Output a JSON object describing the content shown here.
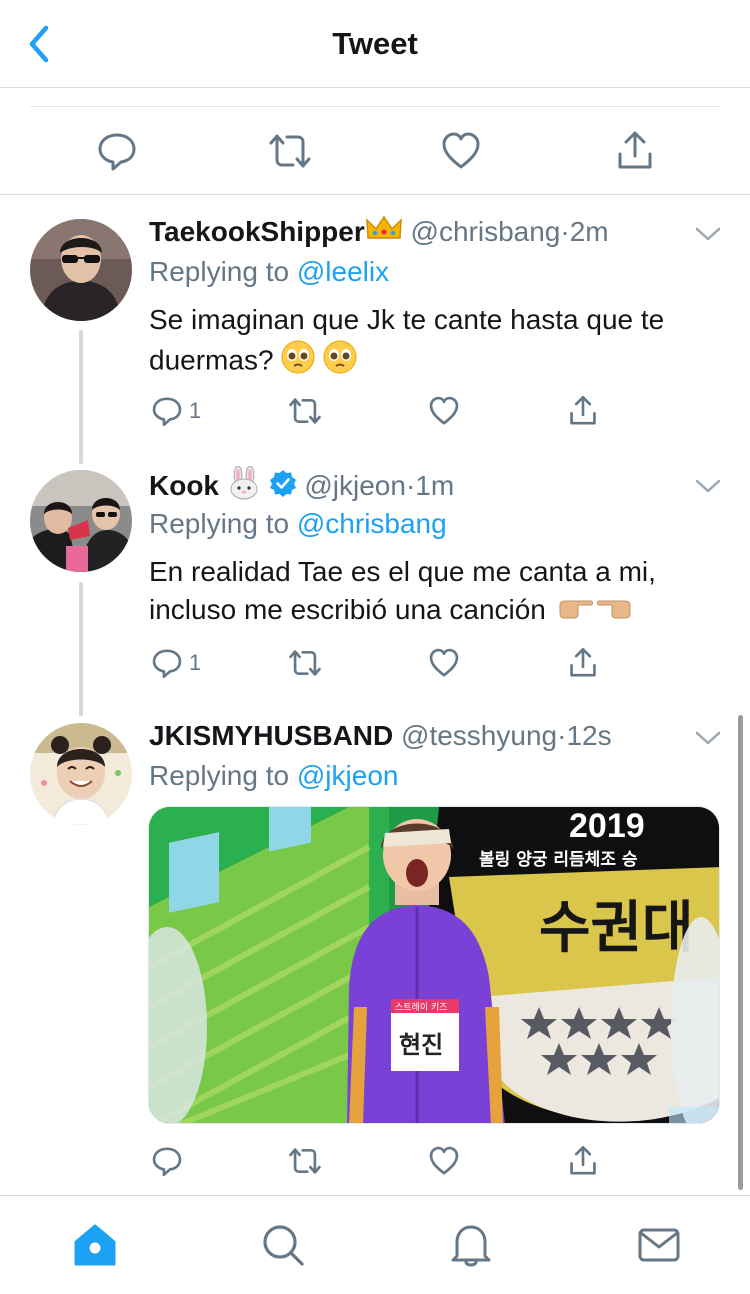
{
  "header": {
    "title": "Tweet"
  },
  "colors": {
    "accent": "#1da1f2",
    "text": "#14171a",
    "muted": "#657786",
    "verified": "#1da1f2"
  },
  "main_actions": [
    {
      "icon": "reply-icon"
    },
    {
      "icon": "retweet-icon"
    },
    {
      "icon": "like-icon"
    },
    {
      "icon": "share-icon"
    }
  ],
  "tweets": [
    {
      "name": "TaekookShipper",
      "name_emoji": "crown",
      "handle": "@chrisbang",
      "sep": "·",
      "time": "2m",
      "replying_label": "Replying to",
      "replying_to": "@leelix",
      "text_line1": "Se imaginan que Jk te cante hasta que te",
      "text_line2": "duermas?",
      "text_emoji": "pleading-face x2",
      "reply_count": "1"
    },
    {
      "name": "Kook",
      "name_emoji": "rabbit",
      "verified": true,
      "handle": "@jkjeon",
      "sep": "·",
      "time": "1m",
      "replying_label": "Replying to",
      "replying_to": "@chrisbang",
      "text_line1": "En realidad Tae es el que me canta a mi,",
      "text_line2": "incluso me escribió una canción",
      "text_emoji": "pointing-fingers",
      "reply_count": "1"
    },
    {
      "name": "JKISMYHUSBAND",
      "handle": "@tesshyung",
      "sep": "·",
      "time": "12s",
      "replying_label": "Replying to",
      "replying_to": "@jkjeon",
      "media": {
        "banner_year": "2019",
        "banner_text": "볼링 양궁 리듬체조 승",
        "big_text": "수권대",
        "name_tag": "현진",
        "tag_top": "스트레이 키즈"
      }
    }
  ],
  "tabbar": [
    {
      "icon": "home-icon",
      "active": true
    },
    {
      "icon": "search-icon",
      "active": false
    },
    {
      "icon": "notifications-icon",
      "active": false
    },
    {
      "icon": "messages-icon",
      "active": false
    }
  ]
}
